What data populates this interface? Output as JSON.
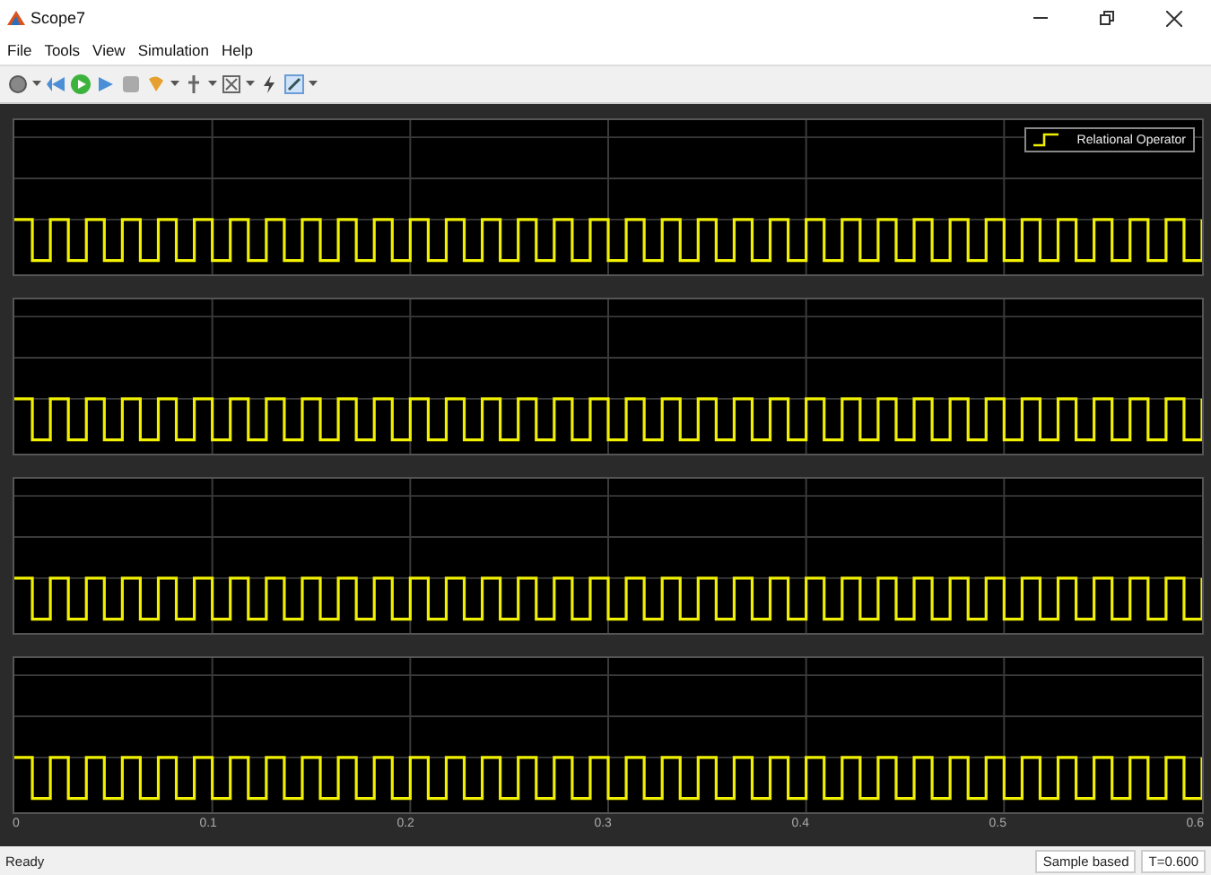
{
  "window": {
    "title": "Scope7"
  },
  "menu": [
    "File",
    "Tools",
    "View",
    "Simulation",
    "Help"
  ],
  "legend": {
    "label": "Relational Operator"
  },
  "panels": [
    {
      "kind": "signal"
    },
    {
      "kind": "signal"
    },
    {
      "kind": "signal"
    },
    {
      "kind": "signal"
    }
  ],
  "x_ticks": [
    "0",
    "0.1",
    "0.2",
    "0.3",
    "0.4",
    "0.5",
    "0.6"
  ],
  "status_bar": {
    "text": "Ready",
    "mode": "Sample based",
    "time": "T=0.600"
  }
}
